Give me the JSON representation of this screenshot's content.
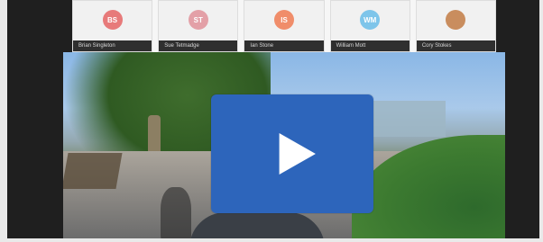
{
  "participants": [
    {
      "initials": "BS",
      "name": "Brian Singleton",
      "color": "#e77a7a"
    },
    {
      "initials": "ST",
      "name": "Sue Tetmadge",
      "color": "#e3a0a7"
    },
    {
      "initials": "IS",
      "name": "Ian Stone",
      "color": "#f08d6a"
    },
    {
      "initials": "WM",
      "name": "William Mott",
      "color": "#7ec5ea"
    },
    {
      "initials": "",
      "name": "Cory Stokes",
      "color": "#c98d5e"
    }
  ],
  "video": {
    "play_label": "Play"
  }
}
